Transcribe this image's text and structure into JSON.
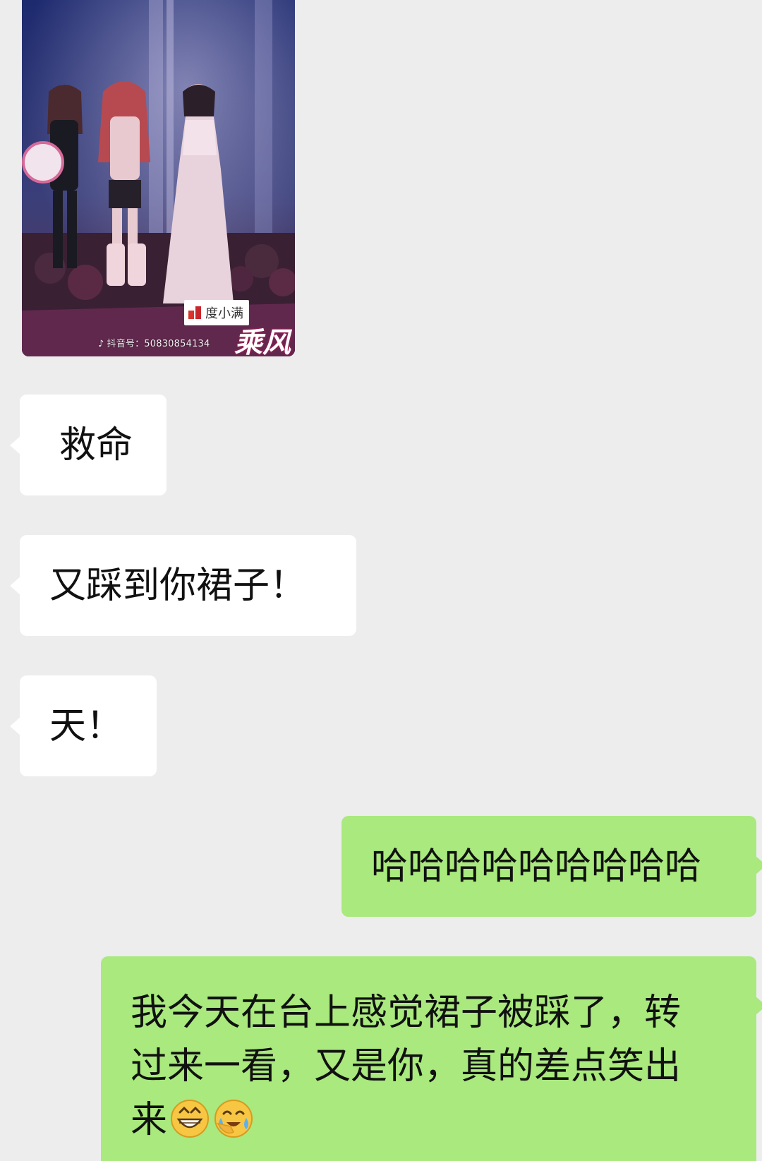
{
  "chat": {
    "image_message": {
      "watermark": "抖音号：50830854134",
      "sponsor": "度小满",
      "show_logo": "乘风"
    },
    "messages": [
      {
        "side": "left",
        "text": "救命"
      },
      {
        "side": "left",
        "text": "又踩到你裙子！"
      },
      {
        "side": "left",
        "text": "天！"
      },
      {
        "side": "right",
        "text": "哈哈哈哈哈哈哈哈哈"
      },
      {
        "side": "right",
        "lines": [
          "我今天在台上感觉裙子被踩了，转",
          "过来一看，又是你，真的差点笑出",
          "来"
        ],
        "emojis": [
          "grinning-face-icon",
          "crying-laughing-face-icon"
        ]
      }
    ]
  },
  "colors": {
    "background": "#ededed",
    "incoming_bubble": "#ffffff",
    "outgoing_bubble": "#a9e97d"
  }
}
